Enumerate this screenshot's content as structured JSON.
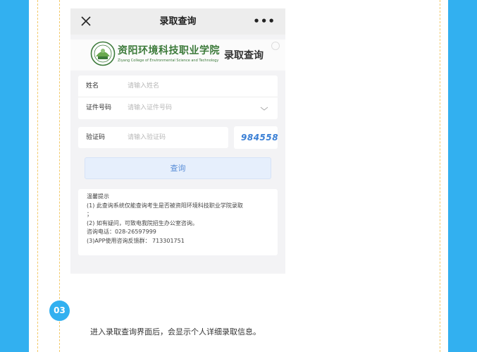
{
  "navbar": {
    "title": "录取查询",
    "more_label": "•••"
  },
  "banner": {
    "school_name": "资阳环境科技职业学院",
    "school_name_en": "Ziyang College of Environmental Science and Technology",
    "title": "录取查询"
  },
  "form": {
    "name_label": "姓名",
    "name_placeholder": "请输入姓名",
    "id_label": "证件号码",
    "id_placeholder": "请输入证件号码",
    "captcha_label": "验证码",
    "captcha_placeholder": "请输入验证码",
    "captcha_code": "984558",
    "submit_label": "查询"
  },
  "tips": {
    "lines": [
      "温馨提示",
      "(1) 此查询系统仅能查询考生是否被资阳环境科技职业学院录取",
      "；",
      "(2) 如有疑问，可致电我院招生办公室咨询。",
      "咨询电话：028-26597999",
      "(3)APP使用咨询反馈群： 713301751"
    ]
  },
  "step": {
    "number": "03",
    "text": "进入录取查询界面后，会显示个人详细录取信息。"
  },
  "colors": {
    "background_blue": "#32b0f0",
    "accent_blue": "#3a7fd5",
    "school_green": "#3c7a3a",
    "dash_yellow": "#f2c96a"
  }
}
